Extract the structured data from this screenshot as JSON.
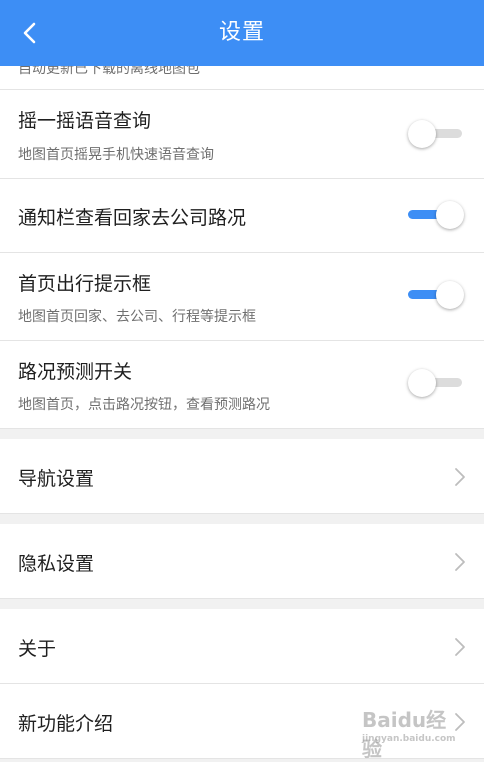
{
  "header": {
    "title": "设置",
    "back_icon": "chevron-left-icon"
  },
  "partial_row": {
    "subtitle": "自动更新已下载的离线地图包"
  },
  "toggles": [
    {
      "title": "摇一摇语音查询",
      "subtitle": "地图首页摇晃手机快速语音查询",
      "on": false
    },
    {
      "title": "通知栏查看回家去公司路况",
      "subtitle": "",
      "on": true
    },
    {
      "title": "首页出行提示框",
      "subtitle": "地图首页回家、去公司、行程等提示框",
      "on": true
    },
    {
      "title": "路况预测开关",
      "subtitle": "地图首页，点击路况按钮，查看预测路况",
      "on": false
    }
  ],
  "nav_items": [
    {
      "label": "导航设置",
      "icon": "chevron-right-icon"
    },
    {
      "label": "隐私设置",
      "icon": "chevron-right-icon"
    },
    {
      "label": "关于",
      "icon": "chevron-right-icon"
    },
    {
      "label": "新功能介绍",
      "icon": "chevron-right-icon"
    }
  ],
  "watermark": {
    "text": "Baidu经验",
    "sub": "jingyan.baidu.com"
  },
  "colors": {
    "accent": "#3d8ef5",
    "background": "#f1f1f1",
    "toggle_off": "#dcdcdc"
  }
}
